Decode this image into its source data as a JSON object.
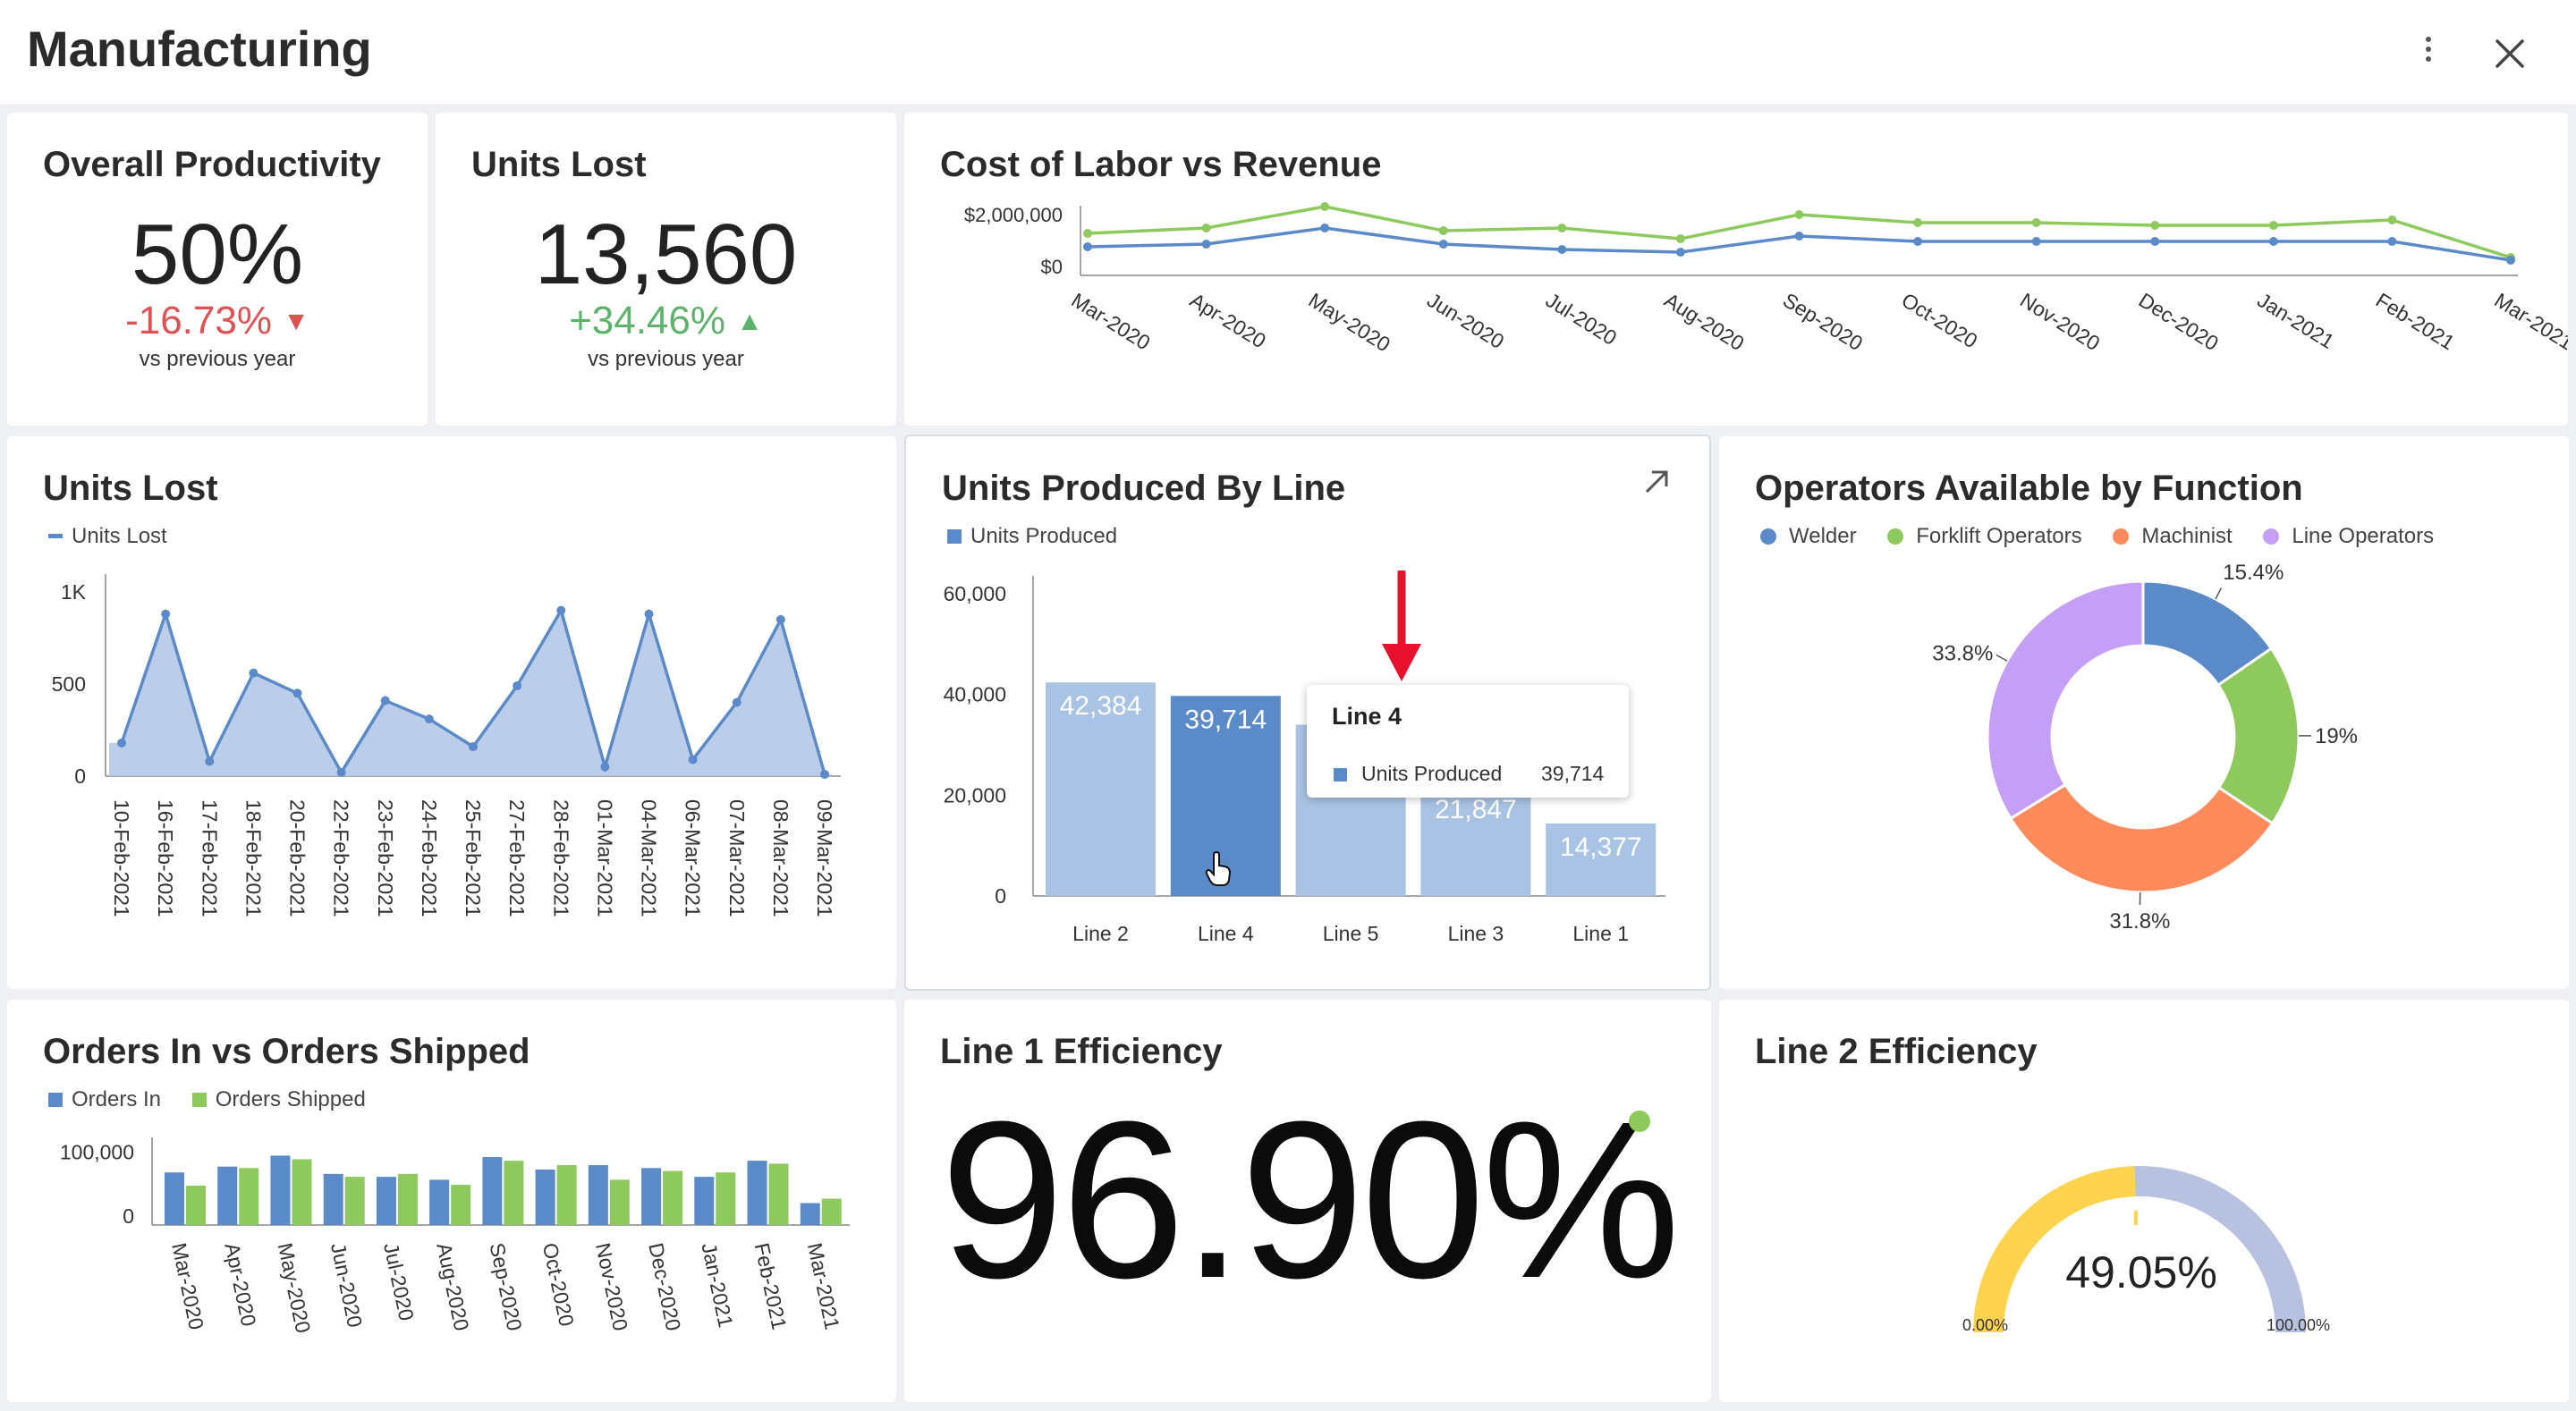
{
  "app": {
    "title": "Manufacturing"
  },
  "colors": {
    "blue": "#5b8ac9",
    "lightBlue": "#a9c3e4",
    "green": "#8ec95e",
    "red": "#e05252",
    "deltaGreen": "#5db36b",
    "purple": "#c59ff5",
    "orange": "#ff8a5c",
    "yellow": "#ffd34e",
    "gaugeGray": "#b8c2e0"
  },
  "productivity": {
    "title": "Overall Productivity",
    "value": "50%",
    "delta": "-16.73%",
    "sub": "vs previous year"
  },
  "units_lost_kpi": {
    "title": "Units Lost",
    "value": "13,560",
    "delta": "+34.46%",
    "sub": "vs previous year"
  },
  "labor_revenue": {
    "title": "Cost of Labor vs Revenue",
    "chart_data": {
      "type": "line",
      "categories": [
        "Mar-2020",
        "Apr-2020",
        "May-2020",
        "Jun-2020",
        "Jul-2020",
        "Aug-2020",
        "Sep-2020",
        "Oct-2020",
        "Nov-2020",
        "Dec-2020",
        "Jan-2021",
        "Feb-2021",
        "Mar-2021"
      ],
      "series": [
        {
          "color": "#8ec95e",
          "values": [
            1300000,
            1500000,
            2300000,
            1400000,
            1500000,
            1100000,
            2000000,
            1700000,
            1700000,
            1600000,
            1600000,
            1800000,
            400000
          ]
        },
        {
          "color": "#5b8ac9",
          "values": [
            800000,
            900000,
            1500000,
            900000,
            700000,
            600000,
            1200000,
            1000000,
            1000000,
            1000000,
            1000000,
            1000000,
            300000
          ]
        }
      ],
      "yticks": [
        "$2,000,000",
        "$0"
      ],
      "ylim": [
        0,
        2000000
      ]
    }
  },
  "units_lost_chart": {
    "title": "Units Lost",
    "legend": "Units Lost",
    "chart_data": {
      "type": "area",
      "categories": [
        "10-Feb-2021",
        "16-Feb-2021",
        "17-Feb-2021",
        "18-Feb-2021",
        "20-Feb-2021",
        "22-Feb-2021",
        "23-Feb-2021",
        "24-Feb-2021",
        "25-Feb-2021",
        "27-Feb-2021",
        "28-Feb-2021",
        "01-Mar-2021",
        "04-Mar-2021",
        "06-Mar-2021",
        "07-Mar-2021",
        "08-Mar-2021",
        "09-Mar-2021"
      ],
      "values": [
        180,
        880,
        80,
        560,
        450,
        20,
        410,
        310,
        160,
        490,
        900,
        50,
        880,
        90,
        400,
        850,
        10
      ],
      "yticks": [
        "1K",
        "500",
        "0"
      ],
      "ylim": [
        0,
        1000
      ]
    }
  },
  "units_produced": {
    "title": "Units Produced By Line",
    "legend": "Units Produced",
    "chart_data": {
      "type": "bar",
      "categories": [
        "Line 2",
        "Line 4",
        "Line 5",
        "Line 3",
        "Line 1"
      ],
      "values": [
        42384,
        39714,
        34000,
        21847,
        14377
      ],
      "labels": [
        "42,384",
        "39,714",
        "",
        "21,847",
        "14,377"
      ],
      "yticks": [
        "60,000",
        "40,000",
        "20,000",
        "0"
      ],
      "ylim": [
        0,
        60000
      ]
    },
    "tooltip": {
      "title": "Line 4",
      "series": "Units Produced",
      "value": "39,714"
    }
  },
  "operators": {
    "title": "Operators Available by Function",
    "chart_data": {
      "type": "pie",
      "labels": [
        "Welder",
        "Forklift Operators",
        "Machinist",
        "Line Operators"
      ],
      "values": [
        15.4,
        19,
        31.8,
        33.8
      ],
      "display": [
        "15.4%",
        "19%",
        "31.8%",
        "33.8%"
      ],
      "colors": [
        "#5b8ac9",
        "#8ec95e",
        "#ff8a5c",
        "#c59ff5"
      ]
    }
  },
  "orders": {
    "title": "Orders In vs Orders Shipped",
    "legend": [
      "Orders In",
      "Orders Shipped"
    ],
    "chart_data": {
      "type": "bar",
      "categories": [
        "Mar-2020",
        "Apr-2020",
        "May-2020",
        "Jun-2020",
        "Jul-2020",
        "Aug-2020",
        "Sep-2020",
        "Oct-2020",
        "Nov-2020",
        "Dec-2020",
        "Jan-2021",
        "Feb-2021",
        "Mar-2021"
      ],
      "series": [
        {
          "name": "Orders In",
          "values": [
            72000,
            80000,
            95000,
            70000,
            66000,
            62000,
            93000,
            76000,
            82000,
            78000,
            66000,
            88000,
            30000
          ]
        },
        {
          "name": "Orders Shipped",
          "values": [
            54000,
            78000,
            90000,
            66000,
            70000,
            55000,
            88000,
            82000,
            62000,
            74000,
            72000,
            84000,
            36000
          ]
        }
      ],
      "yticks": [
        "100,000",
        "0"
      ],
      "ylim": [
        0,
        120000
      ]
    }
  },
  "line1": {
    "title": "Line 1 Efficiency",
    "value": "96.90%"
  },
  "line2": {
    "title": "Line 2 Efficiency",
    "value": "49.05%",
    "min": "0.00%",
    "max": "100.00%",
    "fraction": 0.4905
  }
}
